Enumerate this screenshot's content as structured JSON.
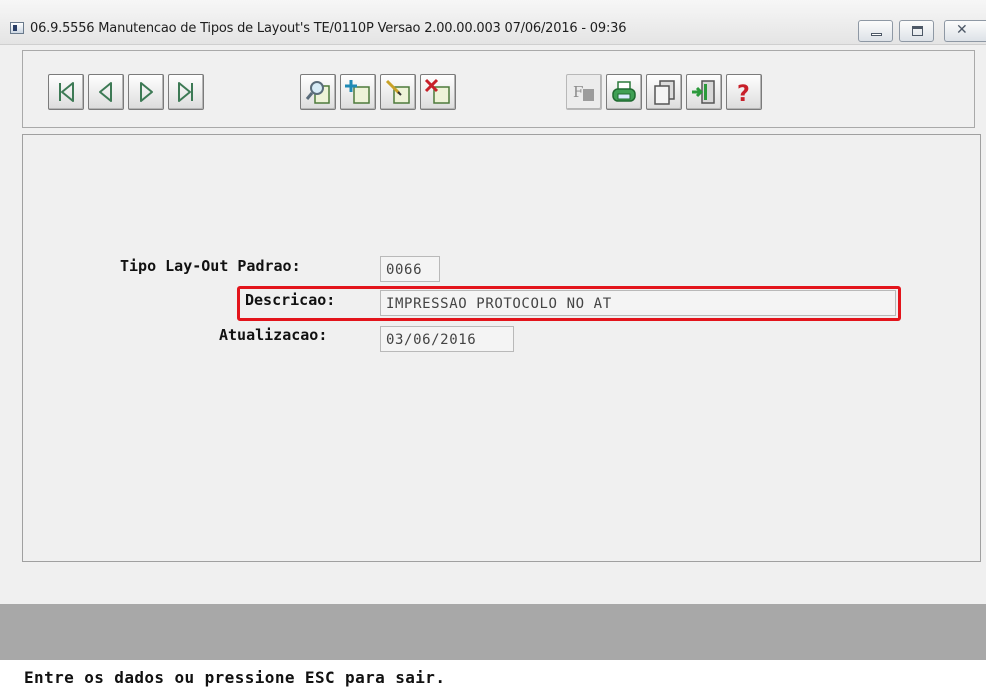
{
  "window": {
    "title": "06.9.5556 Manutencao  de Tipos de Layout's TE/0110P   Versao 2.00.00.003 07/06/2016 - 09:36"
  },
  "toolbar": {
    "navigation": [
      "first-record-icon",
      "previous-record-icon",
      "next-record-icon",
      "last-record-icon"
    ],
    "record_actions": [
      "search-icon",
      "add-record-icon",
      "edit-record-icon",
      "delete-record-icon"
    ],
    "utilities": [
      "filter-icon",
      "print-icon",
      "copy-icon",
      "exit-icon",
      "help-icon"
    ]
  },
  "form": {
    "tipo_layout": {
      "label": "Tipo Lay-Out Padrao:",
      "value": "0066"
    },
    "descricao": {
      "label": "Descricao:",
      "value": "IMPRESSAO PROTOCOLO NO AT"
    },
    "atualizacao": {
      "label": "Atualizacao:",
      "value": "03/06/2016"
    }
  },
  "status": {
    "message": "Entre os dados ou pressione ESC para sair."
  },
  "colors": {
    "highlight": "#e3141b",
    "status_bar": "#a8a8a8"
  }
}
